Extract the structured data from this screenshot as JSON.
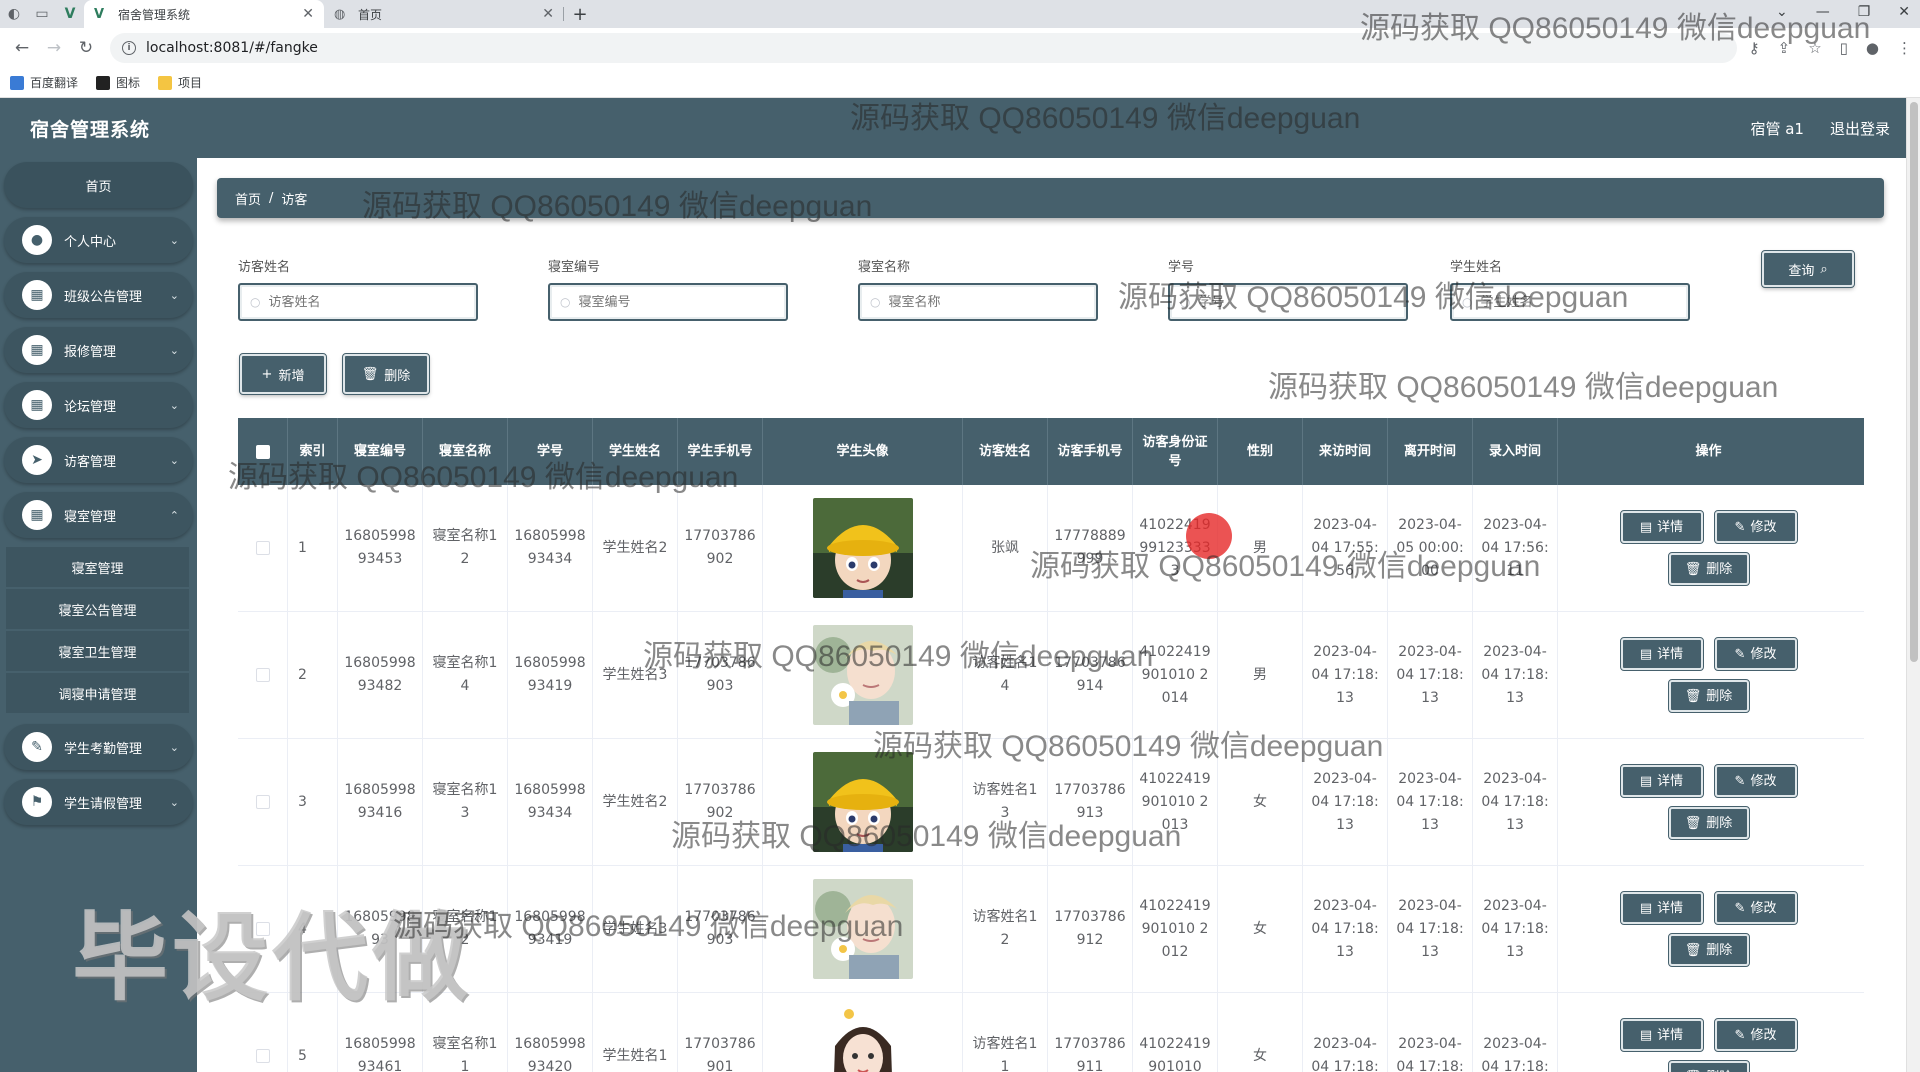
{
  "browser": {
    "tabs": [
      {
        "title": "宿舍管理系统",
        "active": true
      },
      {
        "title": "首页",
        "active": false
      }
    ],
    "url": "localhost:8081/#/fangke",
    "bookmarks": [
      "百度翻译",
      "图标",
      "项目"
    ]
  },
  "header": {
    "title": "宿舍管理系统",
    "user": "宿管 a1",
    "logout": "退出登录"
  },
  "sidebar": {
    "home": "首页",
    "items": [
      {
        "label": "个人中心",
        "icon": "user-icon"
      },
      {
        "label": "班级公告管理",
        "icon": "grid-icon"
      },
      {
        "label": "报修管理",
        "icon": "grid-icon"
      },
      {
        "label": "论坛管理",
        "icon": "grid-icon"
      },
      {
        "label": "访客管理",
        "icon": "send-icon"
      },
      {
        "label": "寝室管理",
        "icon": "grid-icon"
      }
    ],
    "sub_items": [
      "寝室管理",
      "寝室公告管理",
      "寝室卫生管理",
      "调寝申请管理"
    ],
    "items_after": [
      {
        "label": "学生考勤管理",
        "icon": "clipboard-icon"
      },
      {
        "label": "学生请假管理",
        "icon": "leave-icon"
      }
    ]
  },
  "breadcrumb": {
    "home": "首页",
    "sep": "/",
    "current": "访客"
  },
  "search": {
    "fields": [
      {
        "label": "访客姓名",
        "placeholder": "访客姓名"
      },
      {
        "label": "寝室编号",
        "placeholder": "寝室编号"
      },
      {
        "label": "寝室名称",
        "placeholder": "寝室名称"
      },
      {
        "label": "学号",
        "placeholder": "学号"
      },
      {
        "label": "学生姓名",
        "placeholder": "学生姓名"
      }
    ],
    "query_label": "查询"
  },
  "actions": {
    "add": "新增",
    "delete": "删除"
  },
  "table": {
    "headers": [
      "索引",
      "寝室编号",
      "寝室名称",
      "学号",
      "学生姓名",
      "学生手机号",
      "学生头像",
      "访客姓名",
      "访客手机号",
      "访客身份证号",
      "性别",
      "来访时间",
      "离开时间",
      "录入时间",
      "操作"
    ],
    "ops": {
      "detail": "详情",
      "edit": "修改",
      "delete": "删除"
    },
    "rows": [
      {
        "index": "1",
        "room_no": "1680599893453",
        "room_name": "寝室名称12",
        "student_no": "1680599893434",
        "student_name": "学生姓名2",
        "student_phone": "17703786902",
        "avatar": "boy-cap",
        "visitor_name": "张飒",
        "visitor_phone": "17778889999",
        "visitor_id": "41022419991233333",
        "gender": "男",
        "visit_time": "2023-04-04 17:55:56",
        "leave_time": "2023-04-05 00:00:00",
        "entry_time": "2023-04-04 17:56:11"
      },
      {
        "index": "2",
        "room_no": "1680599893482",
        "room_name": "寝室名称14",
        "student_no": "1680599893419",
        "student_name": "学生姓名3",
        "student_phone": "17703786903",
        "avatar": "boy-flower",
        "visitor_name": "访客姓名14",
        "visitor_phone": "17703786914",
        "visitor_id": "41022419901010 2014",
        "gender": "男",
        "visit_time": "2023-04-04 17:18:13",
        "leave_time": "2023-04-04 17:18:13",
        "entry_time": "2023-04-04 17:18:13"
      },
      {
        "index": "3",
        "room_no": "1680599893416",
        "room_name": "寝室名称13",
        "student_no": "1680599893434",
        "student_name": "学生姓名2",
        "student_phone": "17703786902",
        "avatar": "boy-cap",
        "visitor_name": "访客姓名13",
        "visitor_phone": "17703786913",
        "visitor_id": "41022419901010 2013",
        "gender": "女",
        "visit_time": "2023-04-04 17:18:13",
        "leave_time": "2023-04-04 17:18:13",
        "entry_time": "2023-04-04 17:18:13"
      },
      {
        "index": "4",
        "room_no": "1680599893",
        "room_name": "寝室名称12",
        "student_no": "1680599893419",
        "student_name": "学生姓名3",
        "student_phone": "17703786903",
        "avatar": "boy-flower",
        "visitor_name": "访客姓名12",
        "visitor_phone": "17703786912",
        "visitor_id": "41022419901010 2012",
        "gender": "女",
        "visit_time": "2023-04-04 17:18:13",
        "leave_time": "2023-04-04 17:18:13",
        "entry_time": "2023-04-04 17:18:13"
      },
      {
        "index": "5",
        "room_no": "1680599893461",
        "room_name": "寝室名称11",
        "student_no": "1680599893420",
        "student_name": "学生姓名1",
        "student_phone": "17703786901",
        "avatar": "girl",
        "visitor_name": "访客姓名11",
        "visitor_phone": "17703786911",
        "visitor_id": "41022419901010",
        "gender": "女",
        "visit_time": "2023-04-04 17:18:",
        "leave_time": "2023-04-04 17:18:",
        "entry_time": "2023-04-04 17:18:"
      }
    ]
  },
  "watermarks": {
    "text": "源码获取 QQ86050149 微信deepguan",
    "big": "毕设代做"
  }
}
